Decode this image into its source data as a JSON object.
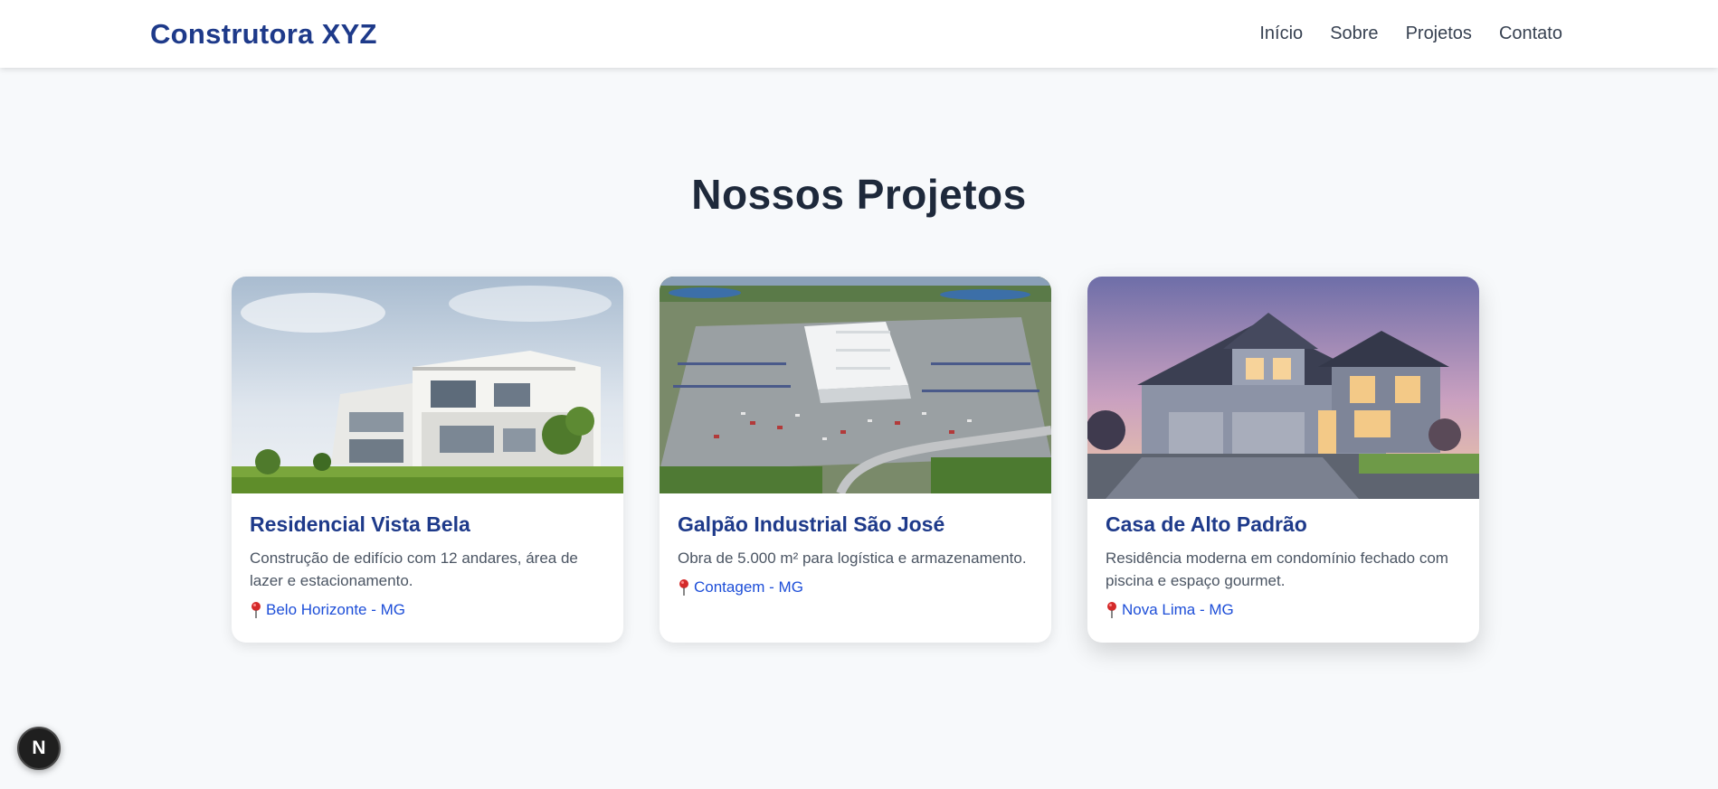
{
  "header": {
    "brand": "Construtora XYZ",
    "nav": [
      {
        "label": "Início"
      },
      {
        "label": "Sobre"
      },
      {
        "label": "Projetos"
      },
      {
        "label": "Contato"
      }
    ]
  },
  "main": {
    "heading": "Nossos Projetos",
    "projects": [
      {
        "title": "Residencial Vista Bela",
        "description": "Construção de edifício com 12 andares, área de lazer e estacionamento.",
        "location": "Belo Horizonte - MG",
        "image_icon": "modern-building-photo"
      },
      {
        "title": "Galpão Industrial São José",
        "description": "Obra de 5.000 m² para logística e armazenamento.",
        "location": "Contagem - MG",
        "image_icon": "industrial-warehouse-aerial-photo"
      },
      {
        "title": "Casa de Alto Padrão",
        "description": "Residência moderna em condomínio fechado com piscina e espaço gourmet.",
        "location": "Nova Lima - MG",
        "image_icon": "luxury-house-photo"
      }
    ]
  },
  "dev_badge": {
    "label": "N"
  },
  "colors": {
    "brand": "#1e3a8a",
    "link": "#1d4ed8",
    "background": "#f7f9fb"
  }
}
